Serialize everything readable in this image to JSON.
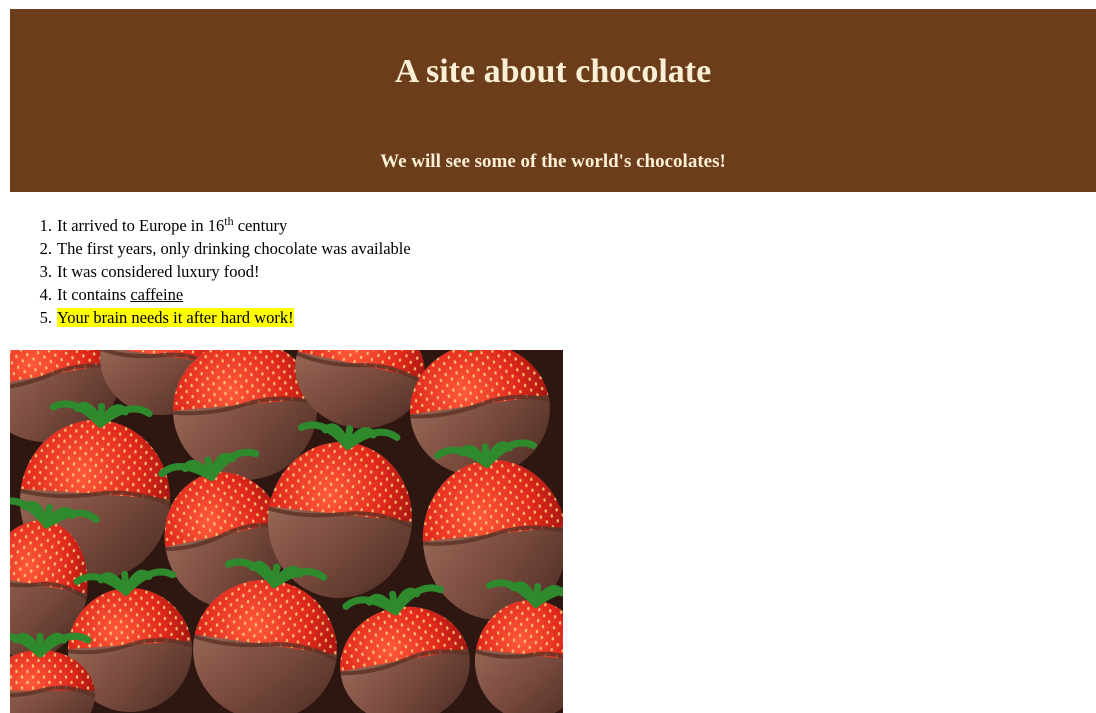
{
  "header": {
    "title": "A site about chocolate",
    "subtitle": "We will see some of the world's chocolates!",
    "background_color": "#6b3d1b",
    "text_color": "#fbefd6"
  },
  "facts": {
    "items": [
      {
        "number": "1.",
        "before": "It arrived to Europe in 16",
        "sup": "th",
        "after": " century"
      },
      {
        "number": "2.",
        "text": "The first years, only drinking chocolate was available"
      },
      {
        "number": "3.",
        "text": "It was considered luxury food!"
      },
      {
        "number": "4.",
        "before": "It contains ",
        "link": "caffeine"
      },
      {
        "number": "5.",
        "highlight": "Your brain needs it after hard work!"
      }
    ],
    "highlight_color": "#ffff00"
  },
  "image": {
    "subject": "chocolate-dipped-strawberries"
  }
}
